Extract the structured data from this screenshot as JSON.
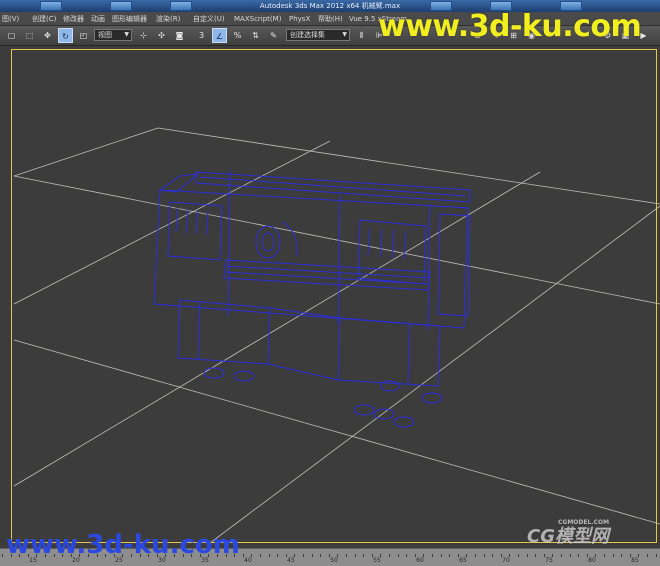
{
  "titlebar": {
    "title": "Autodesk 3ds Max  2012 x64        机械臂.max"
  },
  "menu": [
    {
      "label": "图(V)"
    },
    {
      "label": "创建(C)"
    },
    {
      "label": "修改器"
    },
    {
      "label": "动画"
    },
    {
      "label": "图形编辑器"
    },
    {
      "label": "渲染(R)"
    },
    {
      "label": "自定义(U)"
    },
    {
      "label": "MAXScript(M)"
    },
    {
      "label": "PhysX"
    },
    {
      "label": "帮助(H)"
    },
    {
      "label": "Vue 9.5 xStream"
    }
  ],
  "toolbar": {
    "reference_coord": "视图",
    "named_selection": "创建选择集",
    "icons": [
      "select-icon",
      "select-object-icon",
      "move-icon",
      "rotate-icon",
      "scale-icon",
      "pivot-icon",
      "link-icon",
      "snap-3d-icon",
      "angle-snap-icon",
      "percent-snap-icon",
      "spinner-snap-icon",
      "mirror-icon",
      "align-icon",
      "layer-icon",
      "curve-editor-icon",
      "render-setup-icon",
      "render-icon"
    ]
  },
  "viewport": {
    "border_color": "#e4c64e",
    "grid_color": "#d8d8cc",
    "wire_color": "#2b2fd8"
  },
  "timeline": {
    "labels": [
      "15",
      "20",
      "25",
      "30",
      "35",
      "40",
      "45",
      "50",
      "55",
      "60",
      "65",
      "70",
      "75",
      "80",
      "85",
      "90",
      "95"
    ]
  },
  "watermarks": {
    "top": "www.3d-ku.com",
    "bottom": "www.3d-ku.com",
    "logo": "CG模型网",
    "logo_sub": "CGMODEL.COM"
  }
}
